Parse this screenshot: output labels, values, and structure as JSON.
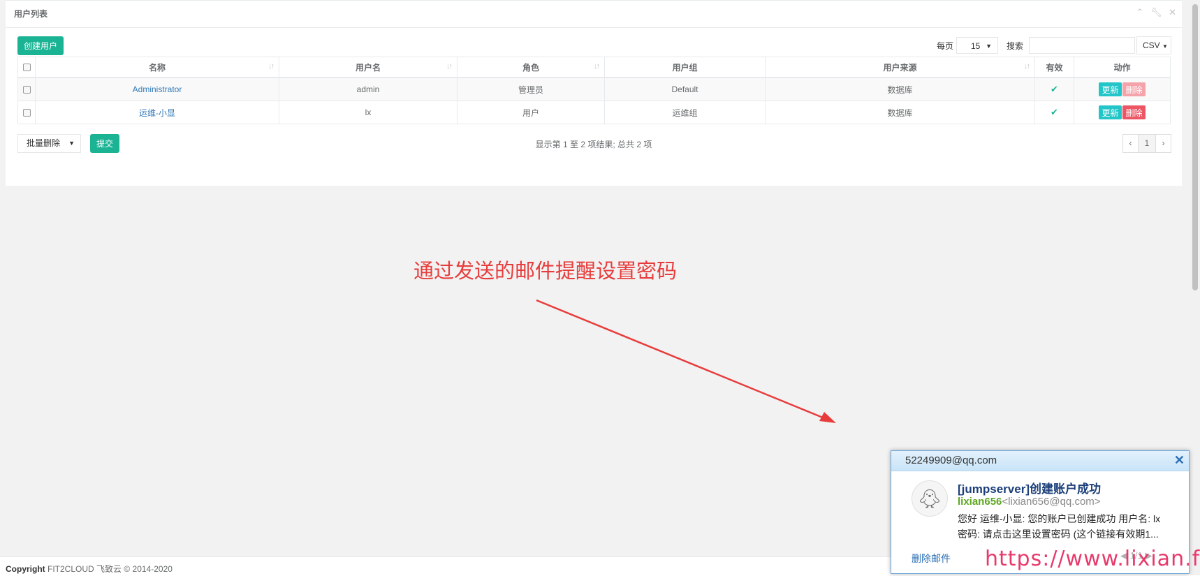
{
  "panel": {
    "title": "用户列表",
    "tools": [
      "chevron-up-icon",
      "wrench-icon",
      "close-icon"
    ]
  },
  "toolbar": {
    "create_label": "创建用户",
    "per_page_label": "每页",
    "per_page_value": "15",
    "search_label": "搜索",
    "search_value": "",
    "export_label": "CSV"
  },
  "table": {
    "columns": [
      "名称",
      "用户名",
      "角色",
      "用户组",
      "用户来源",
      "有效",
      "动作"
    ],
    "rows": [
      {
        "name": "Administrator",
        "username": "admin",
        "role": "管理员",
        "group": "Default",
        "source": "数据库",
        "valid": true
      },
      {
        "name": "运维-小显",
        "username": "lx",
        "role": "用户",
        "group": "运维组",
        "source": "数据库",
        "valid": true
      }
    ],
    "update_label": "更新",
    "delete_label": "删除"
  },
  "bulk": {
    "action_value": "批量删除",
    "submit_label": "提交"
  },
  "info_text": "显示第 1 至 2 项结果; 总共 2 项",
  "pagination": {
    "prev": "‹",
    "current": "1",
    "next": "›"
  },
  "annotation": "通过发送的邮件提醒设置密码",
  "footer": {
    "copyright_label": "Copyright",
    "copyright_text": " FIT2CLOUD 飞致云 © 2014-2020"
  },
  "mail": {
    "account": "52249909@qq.com",
    "subject": "[jumpserver]创建账户成功",
    "sender_name": "lixian656",
    "sender_address": "<lixian656@qq.com>",
    "body_line1": "您好 运维-小显: 您的账户已创建成功 用户名: lx",
    "body_line2": "密码: 请点击这里设置密码 (这个链接有效期1...",
    "delete_label": "删除邮件",
    "pager": "1/1"
  },
  "watermark": "https://www.lixian.fun",
  "colors": {
    "primary": "#1ab394",
    "info": "#23c6c8",
    "danger": "#ed5565",
    "danger_disabled": "#f5a3ab",
    "annotation": "#e83c3c"
  }
}
